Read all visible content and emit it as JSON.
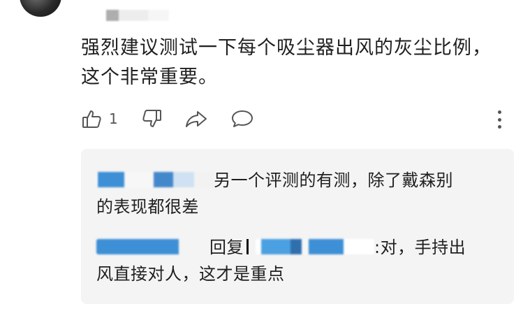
{
  "comment": {
    "text_line1": "强烈建议测试一下每个吸尘器出风的灰尘比例，",
    "text_line2": "这个非常重要。",
    "like_count": "1"
  },
  "replies": [
    {
      "text_line1": "另一个评测的有测，除了戴森别",
      "text_line2": "的表现都很差"
    },
    {
      "reply_prefix": "回复",
      "text_line1": ":对，手持出",
      "text_line2": "风直接对人，这才是重点"
    }
  ],
  "icons": {
    "like": "thumb-up-icon",
    "dislike": "thumb-down-icon",
    "share": "share-icon",
    "reply": "comment-icon",
    "more": "more-vertical-icon"
  }
}
